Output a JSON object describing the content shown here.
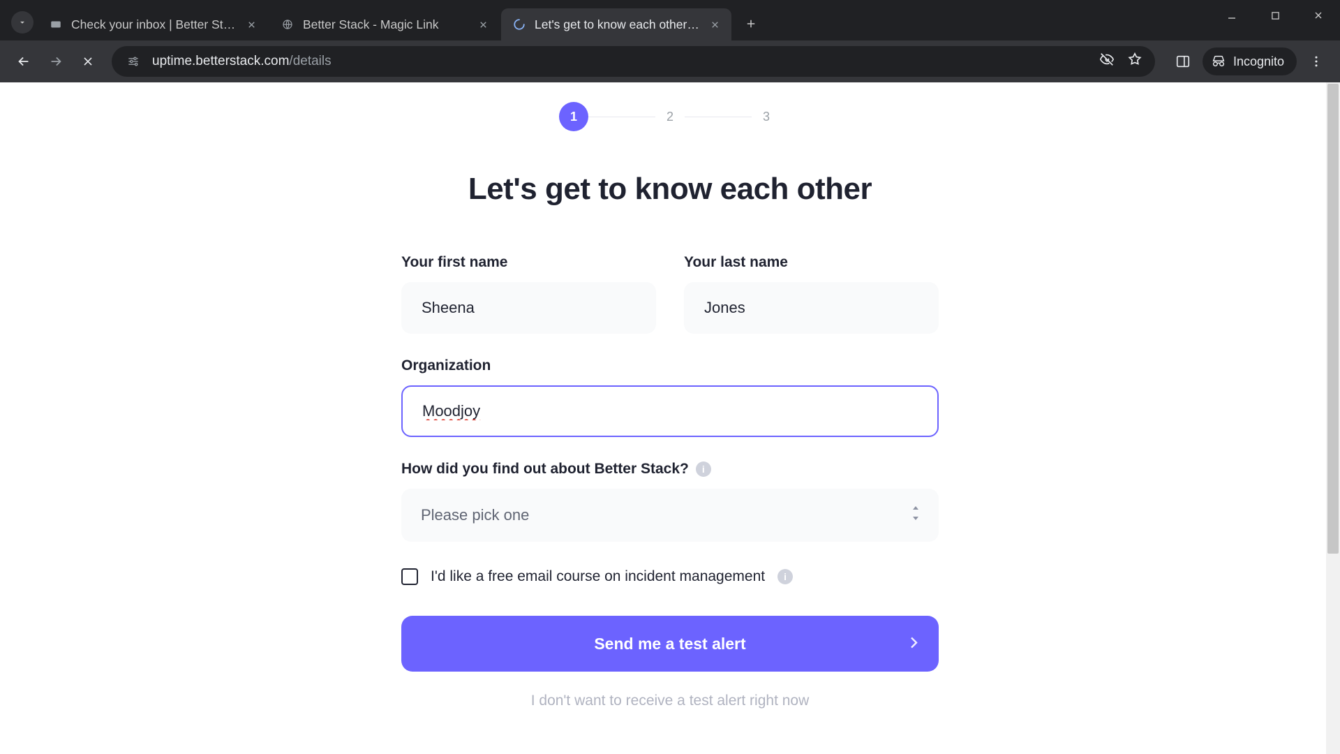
{
  "browser": {
    "tabs": [
      {
        "title": "Check your inbox | Better Stack",
        "active": false
      },
      {
        "title": "Better Stack - Magic Link",
        "active": false
      },
      {
        "title": "Let's get to know each other | B",
        "active": true
      }
    ],
    "url_host": "uptime.betterstack.com",
    "url_path": "/details",
    "incognito_label": "Incognito"
  },
  "stepper": {
    "steps": [
      "1",
      "2",
      "3"
    ],
    "active_index": 0
  },
  "heading": "Let's get to know each other",
  "form": {
    "first_name_label": "Your first name",
    "first_name_value": "Sheena",
    "last_name_label": "Your last name",
    "last_name_value": "Jones",
    "org_label": "Organization",
    "org_value": "Moodjoy",
    "source_label": "How did you find out about Better Stack?",
    "source_placeholder": "Please pick one",
    "checkbox_label": "I'd like a free email course on incident management",
    "submit_label": "Send me a test alert",
    "skip_label": "I don't want to receive a test alert right now"
  },
  "colors": {
    "accent": "#6c63ff"
  }
}
